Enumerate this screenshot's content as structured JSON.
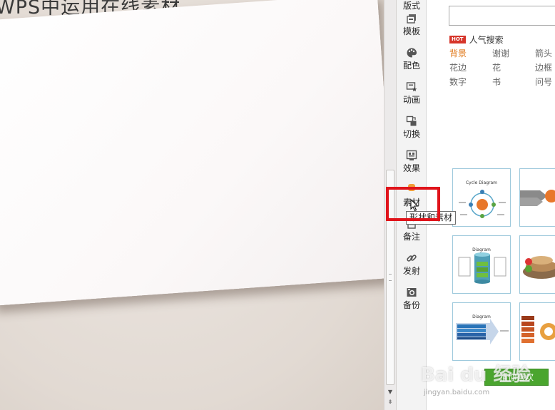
{
  "canvas": {
    "title": "WPS中运用在线素材"
  },
  "nav": {
    "items": [
      {
        "label": "版式",
        "icon": "layout-icon"
      },
      {
        "label": "模板",
        "icon": "template-icon"
      },
      {
        "label": "配色",
        "icon": "palette-icon"
      },
      {
        "label": "动画",
        "icon": "animation-icon"
      },
      {
        "label": "切换",
        "icon": "transition-icon"
      },
      {
        "label": "效果",
        "icon": "effects-icon"
      },
      {
        "label": "素材",
        "icon": "material-icon"
      },
      {
        "label": "备注",
        "icon": "note-icon"
      },
      {
        "label": "发射",
        "icon": "link-icon"
      },
      {
        "label": "备份",
        "icon": "backup-icon"
      }
    ]
  },
  "tooltip": {
    "text": "形状和素材"
  },
  "panel": {
    "search": {
      "value": "",
      "placeholder": ""
    },
    "hot": {
      "badge": "HOT",
      "title": "人气搜索"
    },
    "tags": [
      [
        "背景",
        "谢谢",
        "箭头"
      ],
      [
        "花边",
        "花",
        "边框"
      ],
      [
        "数字",
        "书",
        "问号"
      ]
    ],
    "thumbnails": [
      {
        "title": "Cycle Diagram"
      },
      {
        "title": ""
      },
      {
        "title": "Diagram"
      },
      {
        "title": ""
      },
      {
        "title": "Diagram"
      },
      {
        "title": ""
      }
    ],
    "like_button": "猜你喜欢"
  },
  "watermark": {
    "main": "Bai du 经验",
    "sub": "jingyan.baidu.com"
  },
  "colors": {
    "accent": "#e07a1c",
    "highlight": "#e0141b",
    "like": "#4aa52e",
    "hot": "#d6352b"
  }
}
